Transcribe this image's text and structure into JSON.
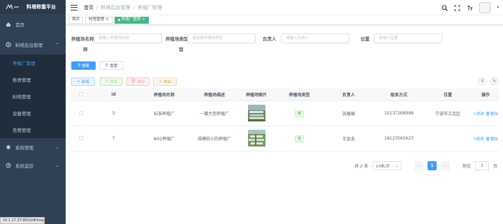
{
  "app": {
    "title": "料塔称重平台"
  },
  "sidebar": {
    "items": [
      {
        "label": "首页",
        "icon": "home-icon"
      },
      {
        "label": "料塔后台管理",
        "icon": "gear-icon",
        "expanded": true,
        "children": [
          {
            "label": "养殖厂管理",
            "active": true
          },
          {
            "label": "栋舍管理"
          },
          {
            "label": "料塔管理"
          },
          {
            "label": "设备管理"
          },
          {
            "label": "告警管理"
          }
        ]
      },
      {
        "label": "系统管理",
        "icon": "settings-icon"
      },
      {
        "label": "系统监控",
        "icon": "monitor-icon"
      }
    ],
    "status_url": "10.1.17.37:8010/#/hogfarm"
  },
  "breadcrumb": {
    "home": "首页",
    "level1": "料塔后台管理",
    "level2": "养殖厂管理"
  },
  "tags": [
    {
      "label": "首页"
    },
    {
      "label": "料塔管理"
    },
    {
      "label": "养殖厂管理"
    }
  ],
  "search": {
    "name_label": "养殖场名称",
    "name_placeholder": "请输入养殖场名称",
    "type_label": "养殖场类型",
    "type_placeholder": "请选择养殖场类型",
    "owner_label": "负责人",
    "owner_placeholder": "请输入负责人",
    "location_label": "位置",
    "location_placeholder": "请输入位置",
    "search_btn": "搜索",
    "reset_btn": "重置"
  },
  "toolbar": {
    "add": "新增",
    "edit": "修改",
    "delete": "删除",
    "export": "导出"
  },
  "table": {
    "columns": [
      "id",
      "养殖场名称",
      "养殖场描述",
      "养殖场图片",
      "养殖场类型",
      "负责人",
      "联系方式",
      "位置",
      "操作"
    ],
    "rows": [
      {
        "id": "3",
        "name": "标准养殖厂",
        "desc": "一撒大型养殖厂",
        "type": "猪",
        "owner": "张展展",
        "phone": "15137268998",
        "location": "宁波市江北区",
        "edit": "修改",
        "delete": "删除"
      },
      {
        "id": "7",
        "name": "#02养殖厂",
        "desc": "规模较小的养殖厂",
        "type": "猪",
        "owner": "王金龙",
        "phone": "18123565623",
        "location": "",
        "edit": "修改",
        "delete": "删除"
      }
    ]
  },
  "pagination": {
    "total": "共 2 条",
    "page_size": "10条/页",
    "current": "1",
    "goto_label": "前往",
    "goto_value": "1",
    "page_suffix": "页"
  },
  "colors": {
    "sidebar_bg": "#304156",
    "accent": "#409eff",
    "tag_active": "#42b983"
  }
}
